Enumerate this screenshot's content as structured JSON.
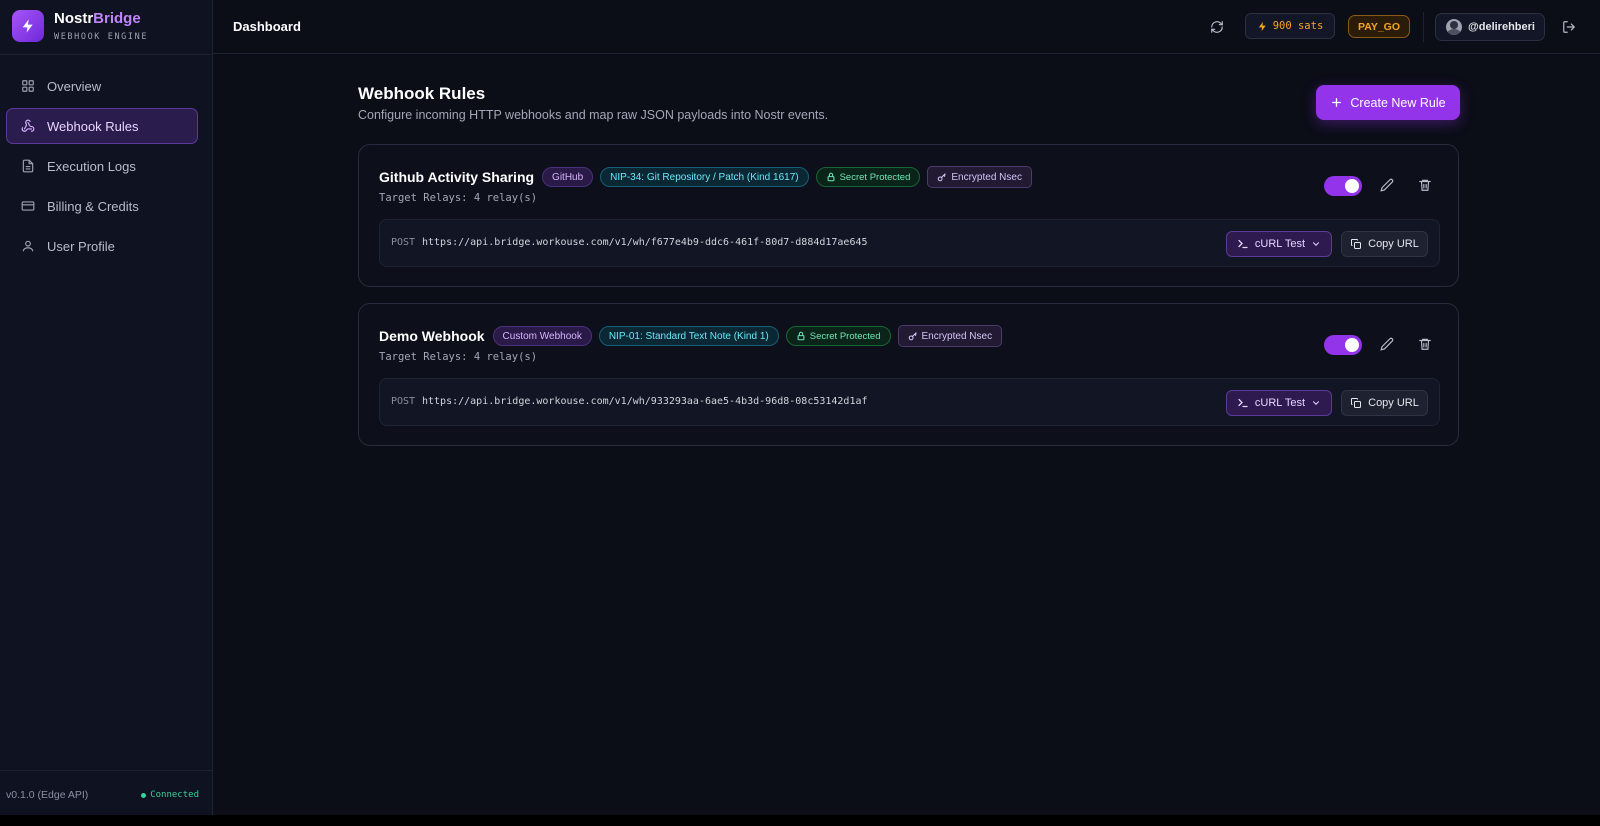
{
  "brand": {
    "name_part1": "Nostr",
    "name_part2": "Bridge",
    "subtitle": "WEBHOOK ENGINE"
  },
  "sidebar": {
    "items": [
      {
        "label": "Overview",
        "icon": "grid-icon",
        "active": false
      },
      {
        "label": "Webhook Rules",
        "icon": "webhook-icon",
        "active": true
      },
      {
        "label": "Execution Logs",
        "icon": "file-text-icon",
        "active": false
      },
      {
        "label": "Billing & Credits",
        "icon": "credit-card-icon",
        "active": false
      },
      {
        "label": "User Profile",
        "icon": "user-icon",
        "active": false
      }
    ],
    "version": "v0.1.0 (Edge API)",
    "connection_status": "Connected"
  },
  "header": {
    "title": "Dashboard",
    "balance": "900 sats",
    "plan": "PAY_GO",
    "username": "@delirehberi"
  },
  "main": {
    "title": "Webhook Rules",
    "description": "Configure incoming HTTP webhooks and map raw JSON payloads into Nostr events.",
    "create_button": "Create New Rule"
  },
  "rules": [
    {
      "name": "Github Activity Sharing",
      "source": "GitHub",
      "kind": "NIP-34: Git Repository / Patch (Kind 1617)",
      "secret": "Secret Protected",
      "nsec": "Encrypted Nsec",
      "relays": "Target Relays: 4 relay(s)",
      "enabled": true,
      "method": "POST",
      "url": "https://api.bridge.workouse.com/v1/wh/f677e4b9-ddc6-461f-80d7-d884d17ae645",
      "curl_label": "cURL Test",
      "copy_label": "Copy URL"
    },
    {
      "name": "Demo Webhook",
      "source": "Custom Webhook",
      "kind": "NIP-01: Standard Text Note (Kind 1)",
      "secret": "Secret Protected",
      "nsec": "Encrypted Nsec",
      "relays": "Target Relays: 4 relay(s)",
      "enabled": true,
      "method": "POST",
      "url": "https://api.bridge.workouse.com/v1/wh/933293aa-6ae5-4b3d-96d8-08c53142d1af",
      "curl_label": "cURL Test",
      "copy_label": "Copy URL"
    }
  ],
  "colors": {
    "accent": "#9333ea",
    "background": "#0b0d17",
    "sidebar": "#0f1220",
    "sats": "#f5a524",
    "connected": "#34d399"
  }
}
